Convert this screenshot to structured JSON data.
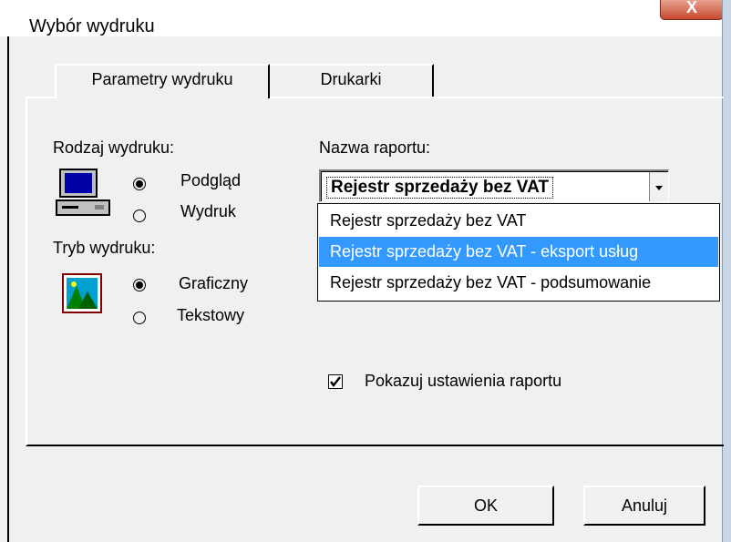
{
  "window": {
    "title": "Wybór wydruku",
    "close_glyph": "X"
  },
  "tabs": [
    {
      "label": "Parametry wydruku",
      "underline_index": 2
    },
    {
      "label": "Drukarki",
      "underline_index": 3
    }
  ],
  "print_type": {
    "label": "Rodzaj wydruku:",
    "options": [
      {
        "label": "Podgląd",
        "selected": true
      },
      {
        "label": "Wydruk",
        "selected": false
      }
    ]
  },
  "print_mode": {
    "label": "Tryb wydruku:",
    "options": [
      {
        "label": "Graficzny",
        "selected": true
      },
      {
        "label": "Tekstowy",
        "selected": false
      }
    ]
  },
  "report": {
    "label": "Nazwa raportu:",
    "selected_value": "Rejestr sprzedaży bez VAT",
    "options": [
      "Rejestr sprzedaży bez VAT",
      "Rejestr sprzedaży bez VAT - eksport usług",
      "Rejestr sprzedaży bez VAT - podsumowanie"
    ],
    "highlighted_index": 1
  },
  "show_settings": {
    "label": "Pokazuj ustawienia raportu",
    "checked": true
  },
  "buttons": {
    "ok": "OK",
    "cancel": "Anuluj"
  },
  "colors": {
    "highlight": "#3399ff",
    "face": "#f0f0f0"
  }
}
